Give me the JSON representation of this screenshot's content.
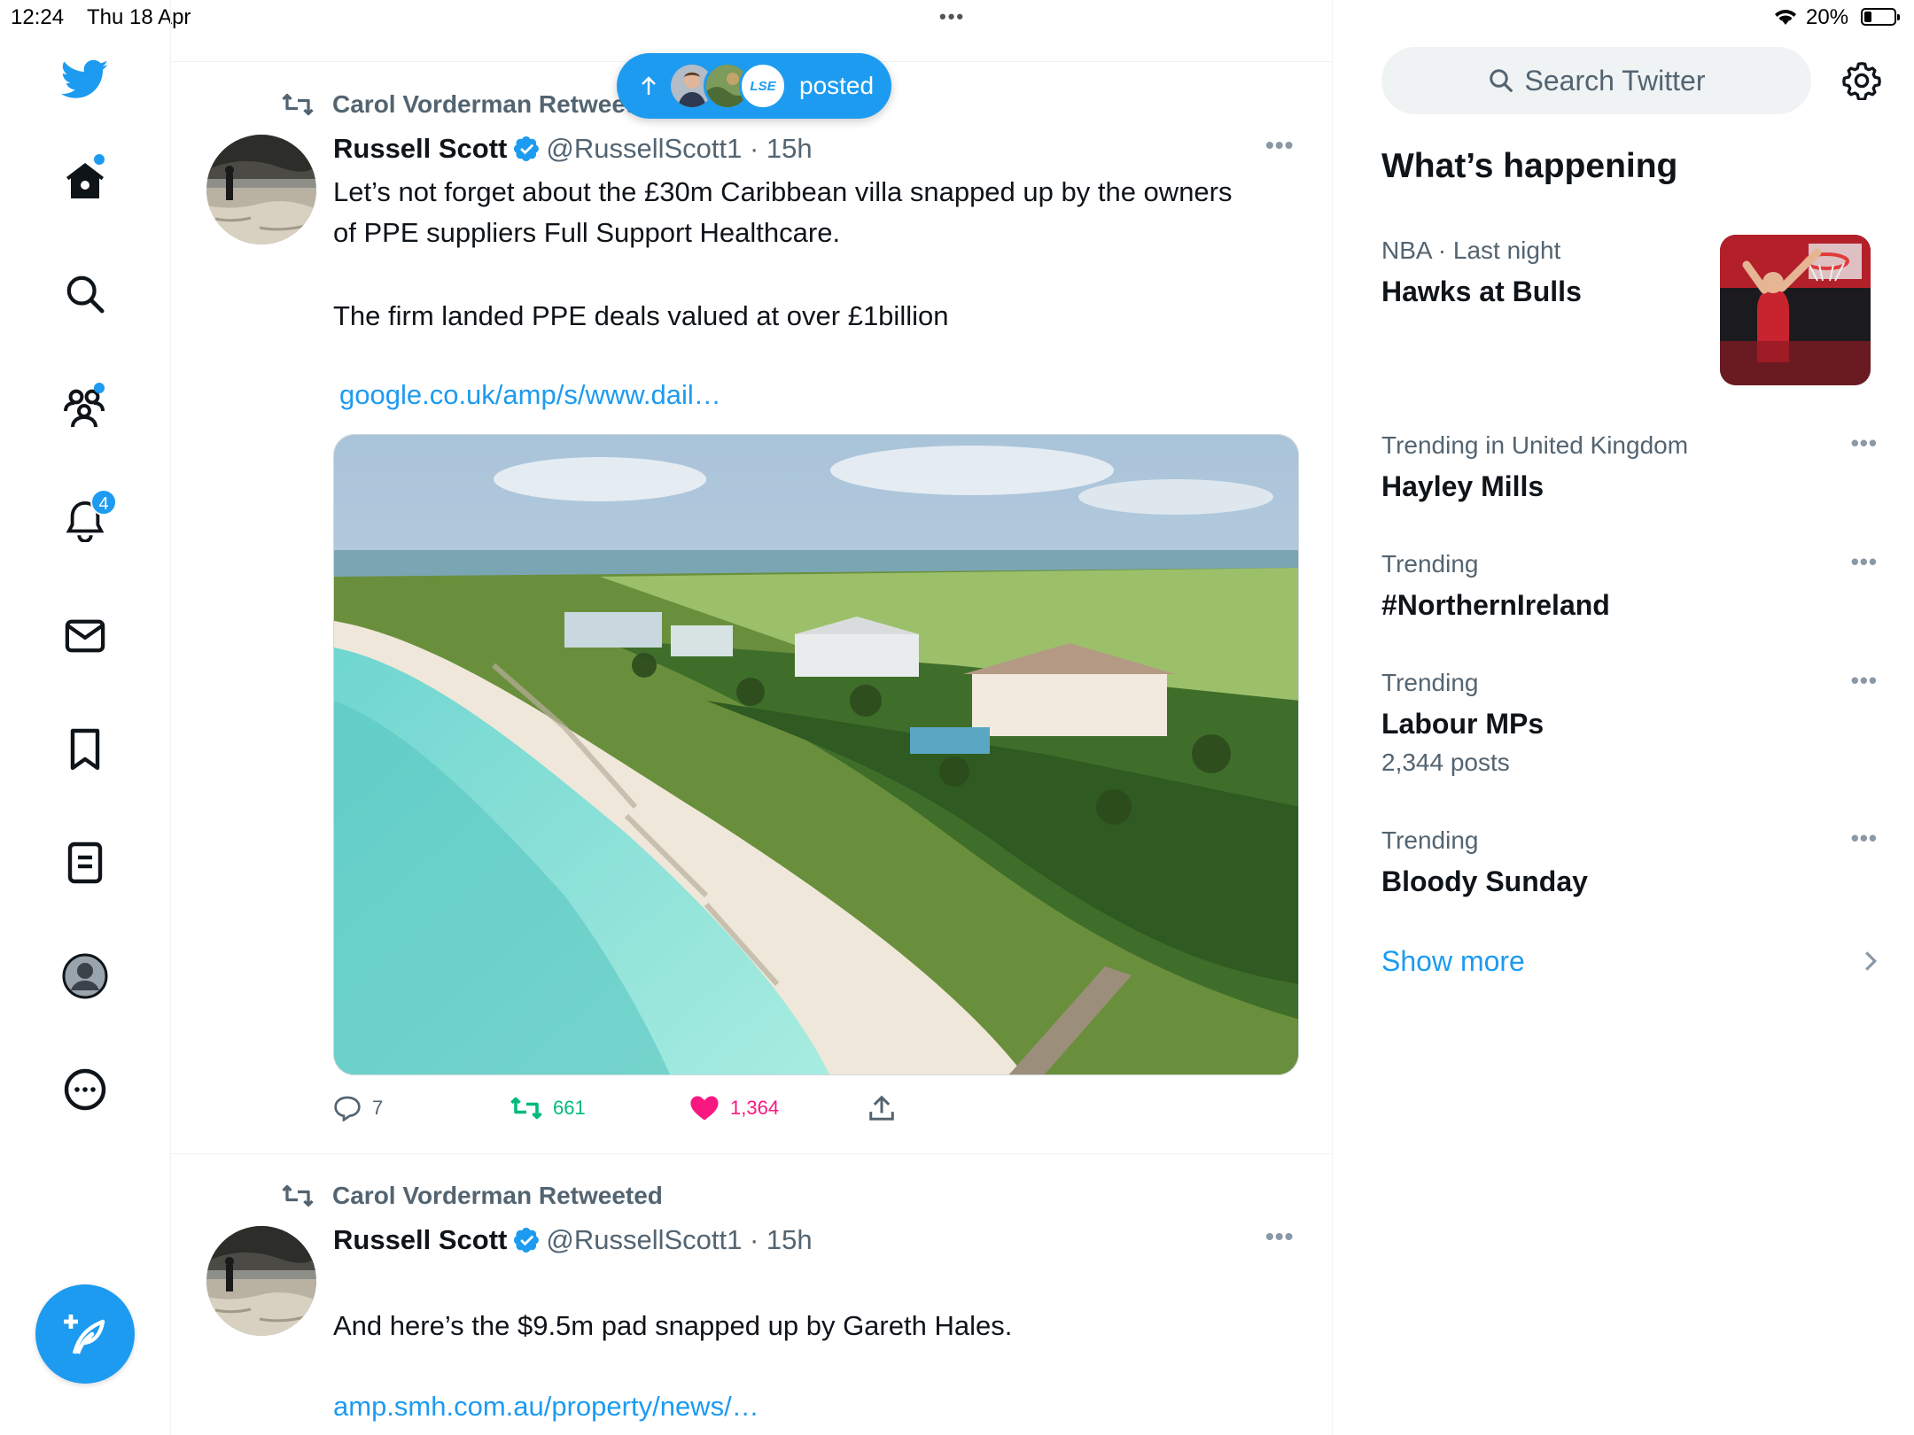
{
  "status_bar": {
    "time": "12:24",
    "date": "Thu 18 Apr",
    "battery": "20%",
    "multitask_indicator": "•••"
  },
  "nav": {
    "items": [
      {
        "name": "home",
        "icon": "home-icon",
        "has_dot": true
      },
      {
        "name": "explore",
        "icon": "search-icon"
      },
      {
        "name": "communities",
        "icon": "communities-icon",
        "has_dot": true
      },
      {
        "name": "notifications",
        "icon": "bell-icon",
        "badge": "4"
      },
      {
        "name": "messages",
        "icon": "mail-icon"
      },
      {
        "name": "bookmarks",
        "icon": "bookmark-icon"
      },
      {
        "name": "lists",
        "icon": "lists-icon"
      },
      {
        "name": "profile",
        "icon": "profile-icon"
      },
      {
        "name": "more",
        "icon": "more-circle-icon"
      }
    ],
    "notifications_badge": "4",
    "compose_icon": "compose-icon"
  },
  "new_posts_pill": {
    "label": "posted",
    "avatar_text": "LSE"
  },
  "tweets": [
    {
      "retweeted_by": "Carol Vorderman Retweeted",
      "name": "Russell Scott",
      "handle": "@RussellScott1 · 15h",
      "paragraph1": "Let’s not forget about the £30m Caribbean villa snapped up by the owners of PPE suppliers Full Support Healthcare.",
      "paragraph2": "The firm landed PPE deals valued at over £1billion",
      "link": "google.co.uk/amp/s/www.dail…",
      "replies": "7",
      "retweets": "661",
      "likes": "1,364"
    },
    {
      "retweeted_by": "Carol Vorderman Retweeted",
      "name": "Russell Scott",
      "handle": "@RussellScott1 · 15h",
      "paragraph1": "And here’s the $9.5m pad snapped up by Gareth Hales.",
      "link": "amp.smh.com.au/property/news/…"
    }
  ],
  "right": {
    "search_placeholder": "Search Twitter",
    "section_title": "What’s happening",
    "trends": [
      {
        "context": "NBA · Last night",
        "topic": "Hawks at Bulls"
      },
      {
        "context": "Trending in United Kingdom",
        "topic": "Hayley Mills"
      },
      {
        "context": "Trending",
        "topic": "#NorthernIreland"
      },
      {
        "context": "Trending",
        "topic": "Labour MPs",
        "count": "2,344 posts"
      },
      {
        "context": "Trending",
        "topic": "Bloody Sunday"
      }
    ],
    "show_more": "Show more"
  },
  "colors": {
    "accent": "#1d9bf0",
    "text": "#0f1419",
    "muted": "#536471",
    "retweet_green": "#00ba7c",
    "like_pink": "#f91880"
  }
}
